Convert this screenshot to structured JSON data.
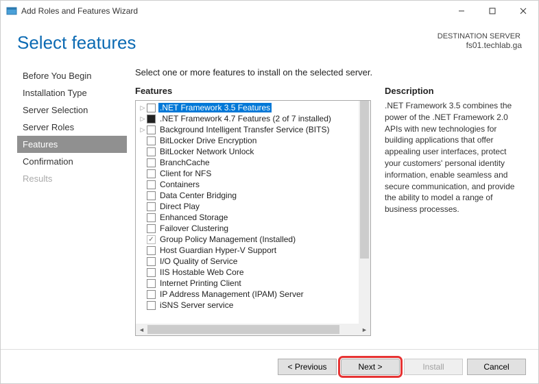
{
  "window": {
    "title": "Add Roles and Features Wizard"
  },
  "header": {
    "pageTitle": "Select features",
    "destLabel": "DESTINATION SERVER",
    "destValue": "fs01.techlab.ga"
  },
  "nav": {
    "items": [
      {
        "label": "Before You Begin",
        "state": "normal"
      },
      {
        "label": "Installation Type",
        "state": "normal"
      },
      {
        "label": "Server Selection",
        "state": "normal"
      },
      {
        "label": "Server Roles",
        "state": "normal"
      },
      {
        "label": "Features",
        "state": "active"
      },
      {
        "label": "Confirmation",
        "state": "normal"
      },
      {
        "label": "Results",
        "state": "disabled"
      }
    ]
  },
  "main": {
    "instruction": "Select one or more features to install on the selected server.",
    "featuresLabel": "Features",
    "descriptionLabel": "Description",
    "descriptionText": ".NET Framework 3.5 combines the power of the .NET Framework 2.0 APIs with new technologies for building applications that offer appealing user interfaces, protect your customers' personal identity information, enable seamless and secure communication, and provide the ability to model a range of business processes."
  },
  "features": [
    {
      "label": ".NET Framework 3.5 Features",
      "expand": true,
      "check": "unchecked",
      "selected": true
    },
    {
      "label": ".NET Framework 4.7 Features (2 of 7 installed)",
      "expand": true,
      "check": "filled"
    },
    {
      "label": "Background Intelligent Transfer Service (BITS)",
      "expand": true,
      "check": "unchecked"
    },
    {
      "label": "BitLocker Drive Encryption",
      "expand": false,
      "check": "unchecked"
    },
    {
      "label": "BitLocker Network Unlock",
      "expand": false,
      "check": "unchecked"
    },
    {
      "label": "BranchCache",
      "expand": false,
      "check": "unchecked"
    },
    {
      "label": "Client for NFS",
      "expand": false,
      "check": "unchecked"
    },
    {
      "label": "Containers",
      "expand": false,
      "check": "unchecked"
    },
    {
      "label": "Data Center Bridging",
      "expand": false,
      "check": "unchecked"
    },
    {
      "label": "Direct Play",
      "expand": false,
      "check": "unchecked"
    },
    {
      "label": "Enhanced Storage",
      "expand": false,
      "check": "unchecked"
    },
    {
      "label": "Failover Clustering",
      "expand": false,
      "check": "unchecked"
    },
    {
      "label": "Group Policy Management (Installed)",
      "expand": false,
      "check": "checked-disabled"
    },
    {
      "label": "Host Guardian Hyper-V Support",
      "expand": false,
      "check": "unchecked"
    },
    {
      "label": "I/O Quality of Service",
      "expand": false,
      "check": "unchecked"
    },
    {
      "label": "IIS Hostable Web Core",
      "expand": false,
      "check": "unchecked"
    },
    {
      "label": "Internet Printing Client",
      "expand": false,
      "check": "unchecked"
    },
    {
      "label": "IP Address Management (IPAM) Server",
      "expand": false,
      "check": "unchecked"
    },
    {
      "label": "iSNS Server service",
      "expand": false,
      "check": "unchecked"
    }
  ],
  "footer": {
    "previous": "< Previous",
    "next": "Next >",
    "install": "Install",
    "cancel": "Cancel"
  }
}
